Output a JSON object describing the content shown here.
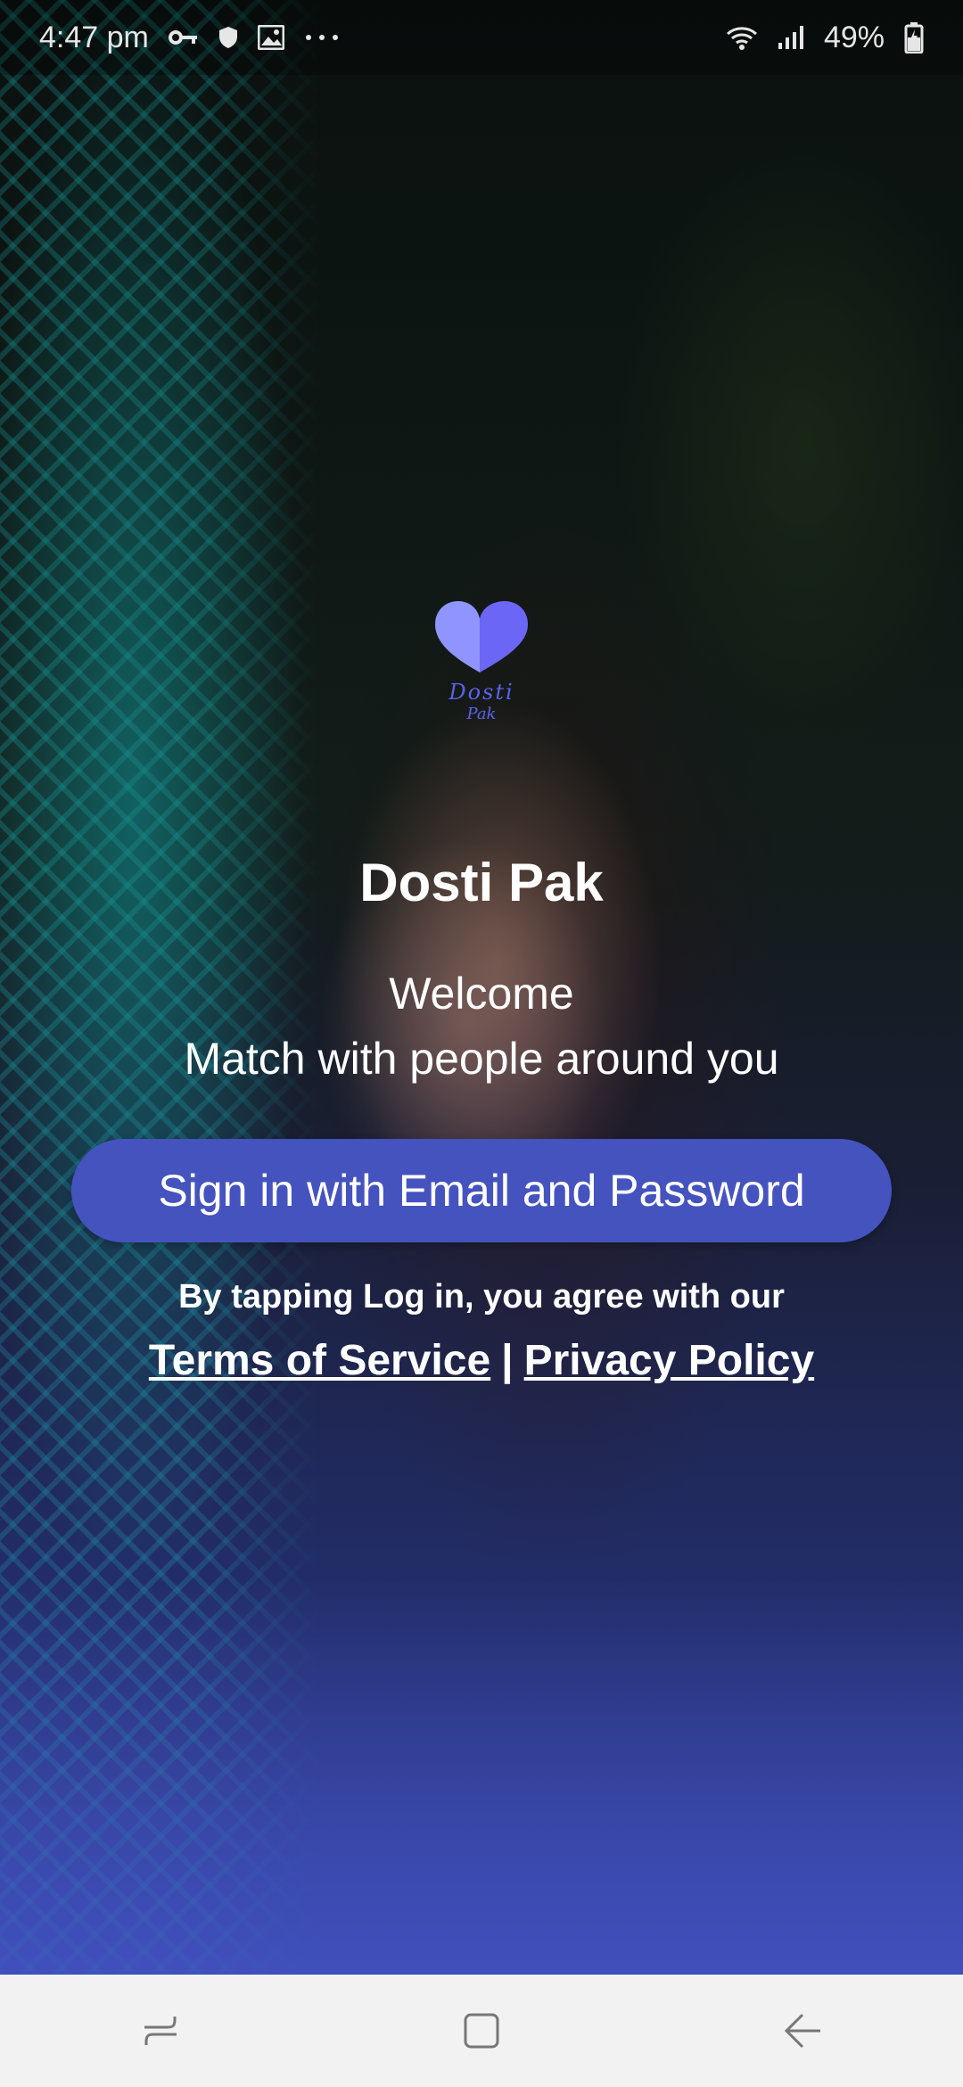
{
  "status_bar": {
    "time": "4:47 pm",
    "battery": "49%",
    "icons": [
      "vpn-key-icon",
      "shield-icon",
      "image-icon",
      "more-dots-icon",
      "wifi-icon",
      "signal-icon",
      "battery-charging-icon"
    ]
  },
  "logo": {
    "line1": "Dosti",
    "line2": "Pak",
    "colors": [
      "#8f94ff",
      "#6b66f5"
    ]
  },
  "app": {
    "title": "Dosti Pak",
    "welcome": "Welcome",
    "subtitle": "Match with people around you"
  },
  "signin": {
    "label": "Sign in with Email and Password",
    "color": "#4553bf"
  },
  "legal": {
    "agree_text": "By tapping Log in, you agree with our",
    "terms": "Terms of Service",
    "separator": "|",
    "privacy": "Privacy Policy"
  },
  "nav": {
    "icons": [
      "recent-apps-icon",
      "home-icon",
      "back-icon"
    ]
  }
}
